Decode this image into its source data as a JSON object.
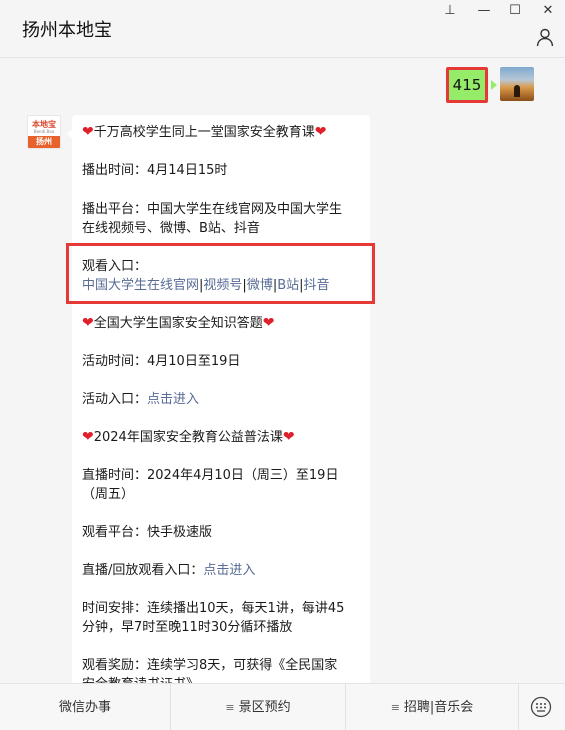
{
  "window": {
    "title": "扬州本地宝",
    "controls": {
      "pin": "⊥",
      "minimize": "—",
      "maximize": "☐",
      "close": "✕"
    }
  },
  "chat": {
    "user_message": "415",
    "bot_avatar": {
      "logo_text": "本地宝",
      "logo_sub": "Bendi Bao",
      "city": "扬州"
    },
    "message": {
      "section1_title": "千万高校学生同上一堂国家安全教育课",
      "broadcast_time": "播出时间：4月14日15时",
      "platform_line1": "播出平台：中国大学生在线官网及中国大学生",
      "platform_line2": "在线视频号、微博、B站、抖音",
      "watch_entry_label": "观看入口：",
      "watch_links": [
        "中国大学生在线官网",
        "视频号",
        "微博",
        "B站",
        "抖音"
      ],
      "section2_title": "全国大学生国家安全知识答题",
      "activity_time": "活动时间：4月10日至19日",
      "activity_entry_label": "活动入口：",
      "activity_entry_link": "点击进入",
      "section3_title": "2024年国家安全教育公益普法课",
      "live_time_line1": "直播时间：2024年4月10日（周三）至19日",
      "live_time_line2": "（周五）",
      "watch_platform": "观看平台：快手极速版",
      "replay_entry_label": "直播/回放观看入口：",
      "replay_entry_link": "点击进入",
      "schedule_line1": "时间安排：连续播出10天，每天1讲，每讲45",
      "schedule_line2": "分钟，早7时至晚11时30分循环播放",
      "reward_line1": "观看奖励：连续学习8天，可获得《全民国家",
      "reward_line2": "安全教育读书证书》"
    }
  },
  "bottom_menu": {
    "items": [
      "微信办事",
      "景区预约",
      "招聘|音乐会"
    ]
  },
  "colors": {
    "link": "#576b95",
    "user_bubble": "#95ec69",
    "highlight_box": "#e53935",
    "heart": "#e01f2d"
  }
}
